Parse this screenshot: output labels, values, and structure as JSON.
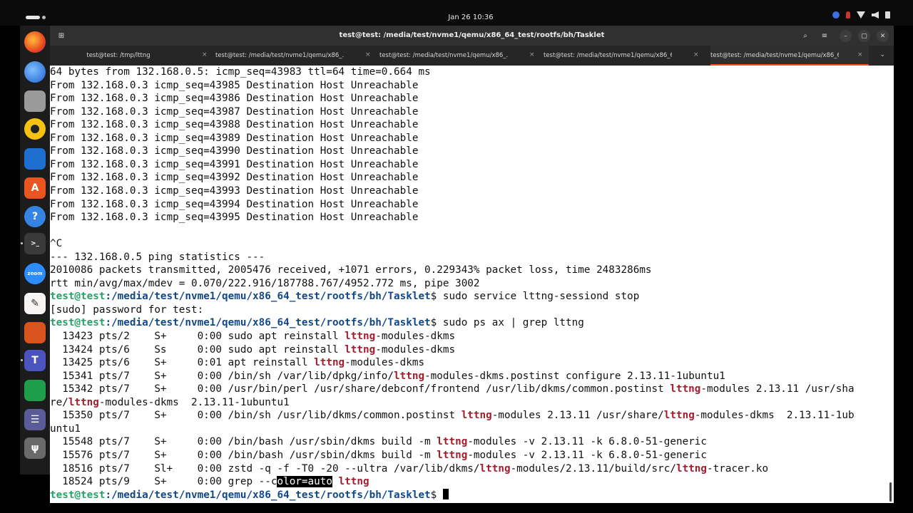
{
  "topbar": {
    "clock": "Jan 26  10:36"
  },
  "window": {
    "title": "test@test: /media/test/nvme1/qemu/x86_64_test/rootfs/bh/Tasklet"
  },
  "tabs": [
    {
      "label": "test@test: /tmp/lttng",
      "active": false
    },
    {
      "label": "test@test: /media/test/nvme1/qemu/x86_...",
      "active": false
    },
    {
      "label": "test@test: /media/test/nvme1/qemu/x86_...",
      "active": false
    },
    {
      "label": "test@test: /media/test/nvme1/qemu/x86_6...",
      "active": false
    },
    {
      "label": "test@test: /media/test/nvme1/qemu/x86_6...",
      "active": true
    }
  ],
  "dock": {
    "apps": [
      "firefox",
      "thunderbird",
      "files",
      "rhythmbox",
      "writer",
      "app-center",
      "help",
      "terminal",
      "zoom",
      "text-editor",
      "impress",
      "teams",
      "calc",
      "disks",
      "usb"
    ]
  },
  "terminal": {
    "prompt_user": "test@test",
    "prompt_path": ":/media/test/nvme1/qemu/x86_64_test/rootfs/bh/Tasklet",
    "lines": [
      [
        {
          "t": "64 bytes from 132.168.0.5: icmp_seq=43983 ttl=64 time=0.664 ms"
        }
      ],
      [
        {
          "t": "From 132.168.0.3 icmp_seq=43985 Destination Host Unreachable"
        }
      ],
      [
        {
          "t": "From 132.168.0.3 icmp_seq=43986 Destination Host Unreachable"
        }
      ],
      [
        {
          "t": "From 132.168.0.3 icmp_seq=43987 Destination Host Unreachable"
        }
      ],
      [
        {
          "t": "From 132.168.0.3 icmp_seq=43988 Destination Host Unreachable"
        }
      ],
      [
        {
          "t": "From 132.168.0.3 icmp_seq=43989 Destination Host Unreachable"
        }
      ],
      [
        {
          "t": "From 132.168.0.3 icmp_seq=43990 Destination Host Unreachable"
        }
      ],
      [
        {
          "t": "From 132.168.0.3 icmp_seq=43991 Destination Host Unreachable"
        }
      ],
      [
        {
          "t": "From 132.168.0.3 icmp_seq=43992 Destination Host Unreachable"
        }
      ],
      [
        {
          "t": "From 132.168.0.3 icmp_seq=43993 Destination Host Unreachable"
        }
      ],
      [
        {
          "t": "From 132.168.0.3 icmp_seq=43994 Destination Host Unreachable"
        }
      ],
      [
        {
          "t": "From 132.168.0.3 icmp_seq=43995 Destination Host Unreachable"
        }
      ],
      [
        {
          "t": ""
        }
      ],
      [
        {
          "t": "^C"
        }
      ],
      [
        {
          "t": "--- 132.168.0.5 ping statistics ---"
        }
      ],
      [
        {
          "t": "2010086 packets transmitted, 2005476 received, +1071 errors, 0.229343% packet loss, time 2483286ms"
        }
      ],
      [
        {
          "t": "rtt min/avg/max/mdev = 0.070/222.916/187788.767/4952.772 ms, pipe 3002"
        }
      ],
      [
        {
          "t": "test@test",
          "c": "p-user"
        },
        {
          "t": ":/media/test/nvme1/qemu/x86_64_test/rootfs/bh/Tasklet",
          "c": "p-path"
        },
        {
          "t": "$ sudo service lttng-sessiond stop"
        }
      ],
      [
        {
          "t": "[sudo] password for test:"
        }
      ],
      [
        {
          "t": "test@test",
          "c": "p-user"
        },
        {
          "t": ":/media/test/nvme1/qemu/x86_64_test/rootfs/bh/Tasklet",
          "c": "p-path"
        },
        {
          "t": "$ sudo ps ax | grep lttng"
        }
      ],
      [
        {
          "t": "  13423 pts/2    S+     0:00 sudo apt reinstall "
        },
        {
          "t": "lttng",
          "c": "hl"
        },
        {
          "t": "-modules-dkms"
        }
      ],
      [
        {
          "t": "  13424 pts/6    Ss     0:00 sudo apt reinstall "
        },
        {
          "t": "lttng",
          "c": "hl"
        },
        {
          "t": "-modules-dkms"
        }
      ],
      [
        {
          "t": "  13425 pts/6    S+     0:01 apt reinstall "
        },
        {
          "t": "lttng",
          "c": "hl"
        },
        {
          "t": "-modules-dkms"
        }
      ],
      [
        {
          "t": "  15341 pts/7    S+     0:00 /bin/sh /var/lib/dpkg/info/"
        },
        {
          "t": "lttng",
          "c": "hl"
        },
        {
          "t": "-modules-dkms.postinst configure 2.13.11-1ubuntu1"
        }
      ],
      [
        {
          "t": "  15342 pts/7    S+     0:00 /usr/bin/perl /usr/share/debconf/frontend /usr/lib/dkms/common.postinst "
        },
        {
          "t": "lttng",
          "c": "hl"
        },
        {
          "t": "-modules 2.13.11 /usr/sha"
        }
      ],
      [
        {
          "t": "re/"
        },
        {
          "t": "lttng",
          "c": "hl"
        },
        {
          "t": "-modules-dkms  2.13.11-1ubuntu1"
        }
      ],
      [
        {
          "t": "  15350 pts/7    S+     0:00 /bin/sh /usr/lib/dkms/common.postinst "
        },
        {
          "t": "lttng",
          "c": "hl"
        },
        {
          "t": "-modules 2.13.11 /usr/share/"
        },
        {
          "t": "lttng",
          "c": "hl"
        },
        {
          "t": "-modules-dkms  2.13.11-1ub"
        }
      ],
      [
        {
          "t": "untu1"
        }
      ],
      [
        {
          "t": "  15548 pts/7    S+     0:00 /bin/bash /usr/sbin/dkms build -m "
        },
        {
          "t": "lttng",
          "c": "hl"
        },
        {
          "t": "-modules -v 2.13.11 -k 6.8.0-51-generic"
        }
      ],
      [
        {
          "t": "  15576 pts/7    S+     0:00 /bin/bash /usr/sbin/dkms build -m "
        },
        {
          "t": "lttng",
          "c": "hl"
        },
        {
          "t": "-modules -v 2.13.11 -k 6.8.0-51-generic"
        }
      ],
      [
        {
          "t": "  18516 pts/7    Sl+    0:00 zstd -q -f -T0 -20 --ultra /var/lib/dkms/"
        },
        {
          "t": "lttng",
          "c": "hl"
        },
        {
          "t": "-modules/2.13.11/build/src/"
        },
        {
          "t": "lttng",
          "c": "hl"
        },
        {
          "t": "-tracer.ko"
        }
      ],
      [
        {
          "t": "  18524 pts/9    S+     0:00 grep --c"
        },
        {
          "t": "olor=auto",
          "c": "sel"
        },
        {
          "t": " "
        },
        {
          "t": "lttng",
          "c": "hl"
        }
      ],
      [
        {
          "t": "test@test",
          "c": "p-user"
        },
        {
          "t": ":/media/test/nvme1/qemu/x86_64_test/rootfs/bh/Tasklet",
          "c": "p-path"
        },
        {
          "t": "$ "
        },
        {
          "t": "",
          "c": "cursor"
        }
      ]
    ]
  }
}
